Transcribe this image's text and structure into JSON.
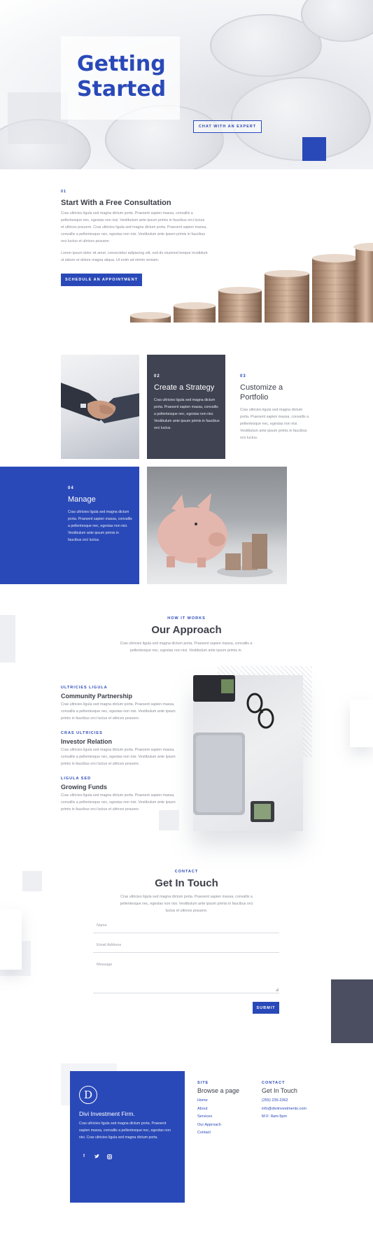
{
  "hero": {
    "title_line1": "Getting",
    "title_line2": "Started",
    "cta_label": "CHAT WITH AN EXPERT"
  },
  "consult": {
    "number": "01",
    "title": "Start With a Free Consultation",
    "paragraph1": "Cras ultricies ligula sed magna dictum porta. Praesent sapien massa, convallis a pellentesque nec, egestas non nisi. Vestibulum ante ipsum primis in faucibus orci luctus et ultrices posuere. Cras ultricies ligula sed magna dictum porta. Praesent sapien massa, convallis a pellentesque nec, egestas non nisi. Vestibulum ante ipsum primis in faucibus orci luctus et ultrices posuere.",
    "paragraph2": "Lorem ipsum dolor sit amet, consectetur adipiscing elit, sed do eiusmod tempor incididunt ut labore et dolore magna aliqua. Ut enim ad minim veniam.",
    "button_label": "SCHEDULE AN APPOINTMENT"
  },
  "steps": [
    {
      "number": "02",
      "title": "Create a Strategy",
      "text": "Cras ultricies ligula sed magna dictum porta. Praesent sapien massa, convallis a pellentesque nec, egestas non nisi. Vestibulum ante ipsum primis in faucibus orci luctus."
    },
    {
      "number": "03",
      "title": "Customize a Portfolio",
      "text": "Cras ultricies ligula sed magna dictum porta. Praesent sapien massa, convallis a pellentesque nec, egestas non nisi. Vestibulum ante ipsum primis in faucibus orci luctus."
    },
    {
      "number": "04",
      "title": "Manage",
      "text": "Cras ultricies ligula sed magna dictum porta. Praesent sapien massa, convallis a pellentesque nec, egestas non nisi. Vestibulum ante ipsum primis in faucibus orci luctus."
    }
  ],
  "approach": {
    "eyebrow": "HOW IT WORKS",
    "title": "Our Approach",
    "description": "Cras ultricies ligula sed magna dictum porta. Praesent sapien massa, convallis a pellentesque nec, egestas non nisi. Vestibulum ante ipsum primis in.",
    "features": [
      {
        "eyebrow": "ULTRICIES LIGULA",
        "title": "Community Partnership",
        "text": "Cras ultricies ligula sed magna dictum porta. Praesent sapien massa, convallis a pellentesque nec, egestas non nisi. Vestibulum ante ipsum primis in faucibus orci luctus et ultrices posuere."
      },
      {
        "eyebrow": "CRAS ULTRICIES",
        "title": "Investor Relation",
        "text": "Cras ultricies ligula sed magna dictum porta. Praesent sapien massa, convallis a pellentesque nec, egestas non nisi. Vestibulum ante ipsum primis in faucibus orci luctus et ultrices posuere."
      },
      {
        "eyebrow": "LIGULA SED",
        "title": "Growing Funds",
        "text": "Cras ultricies ligula sed magna dictum porta. Praesent sapien massa, convallis a pellentesque nec, egestas non nisi. Vestibulum ante ipsum primis in faucibus orci luctus et ultrices posuere."
      }
    ]
  },
  "contact": {
    "eyebrow": "CONTACT",
    "title": "Get In Touch",
    "description": "Cras ultricies ligula sed magna dictum porta. Praesent sapien massa, convallis a pellentesque nec, egestas non nisi. Vestibulum ante ipsum primis in faucibus orci luctus et ultrices posuere.",
    "fields": {
      "name_placeholder": "Name",
      "email_placeholder": "Email Address",
      "message_placeholder": "Message"
    },
    "submit_label": "SUBMIT"
  },
  "footer": {
    "logo_letter": "D",
    "company_name": "Divi Investment Firm.",
    "about": "Cras ultricies ligula sed magna dictum porta. Praesent sapien massa, convallis a pellentesque nec, egestas non nisi. Cras ultricies ligula sed magna dictum porta.",
    "social": [
      "f",
      "t",
      "ig"
    ],
    "site": {
      "eyebrow": "SITE",
      "title": "Browse a page",
      "links": [
        "Home",
        "About",
        "Services",
        "Our Approach",
        "Contact"
      ]
    },
    "contact": {
      "eyebrow": "CONTACT",
      "title": "Get In Touch",
      "lines": [
        "(255) 235-2362",
        "info@diviinvestments.com",
        "M-F: 8am-5pm"
      ]
    }
  },
  "colors": {
    "accent": "#2a49b8",
    "dark_card": "#3f4352",
    "dark_block": "#4a4e60"
  }
}
